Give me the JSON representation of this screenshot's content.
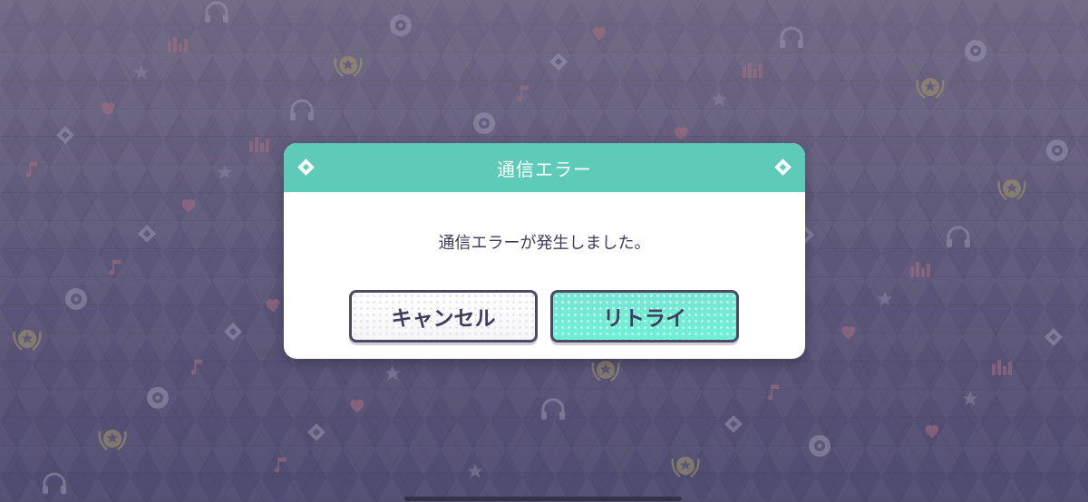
{
  "dialog": {
    "title": "通信エラー",
    "message": "通信エラーが発生しました。",
    "cancel_label": "キャンセル",
    "retry_label": "リトライ"
  },
  "colors": {
    "header_teal": "#5ecbb8",
    "retry_button": "#72e9d4",
    "background_purple": "#5e587a",
    "text_dark": "#3e3c5a"
  },
  "icons": {
    "background_decorations": [
      "star-icon",
      "diamond-icon",
      "heart-icon",
      "headphones-icon",
      "music-note-icon",
      "cd-disc-icon",
      "equalizer-icon",
      "laurel-star-badge-icon"
    ]
  }
}
